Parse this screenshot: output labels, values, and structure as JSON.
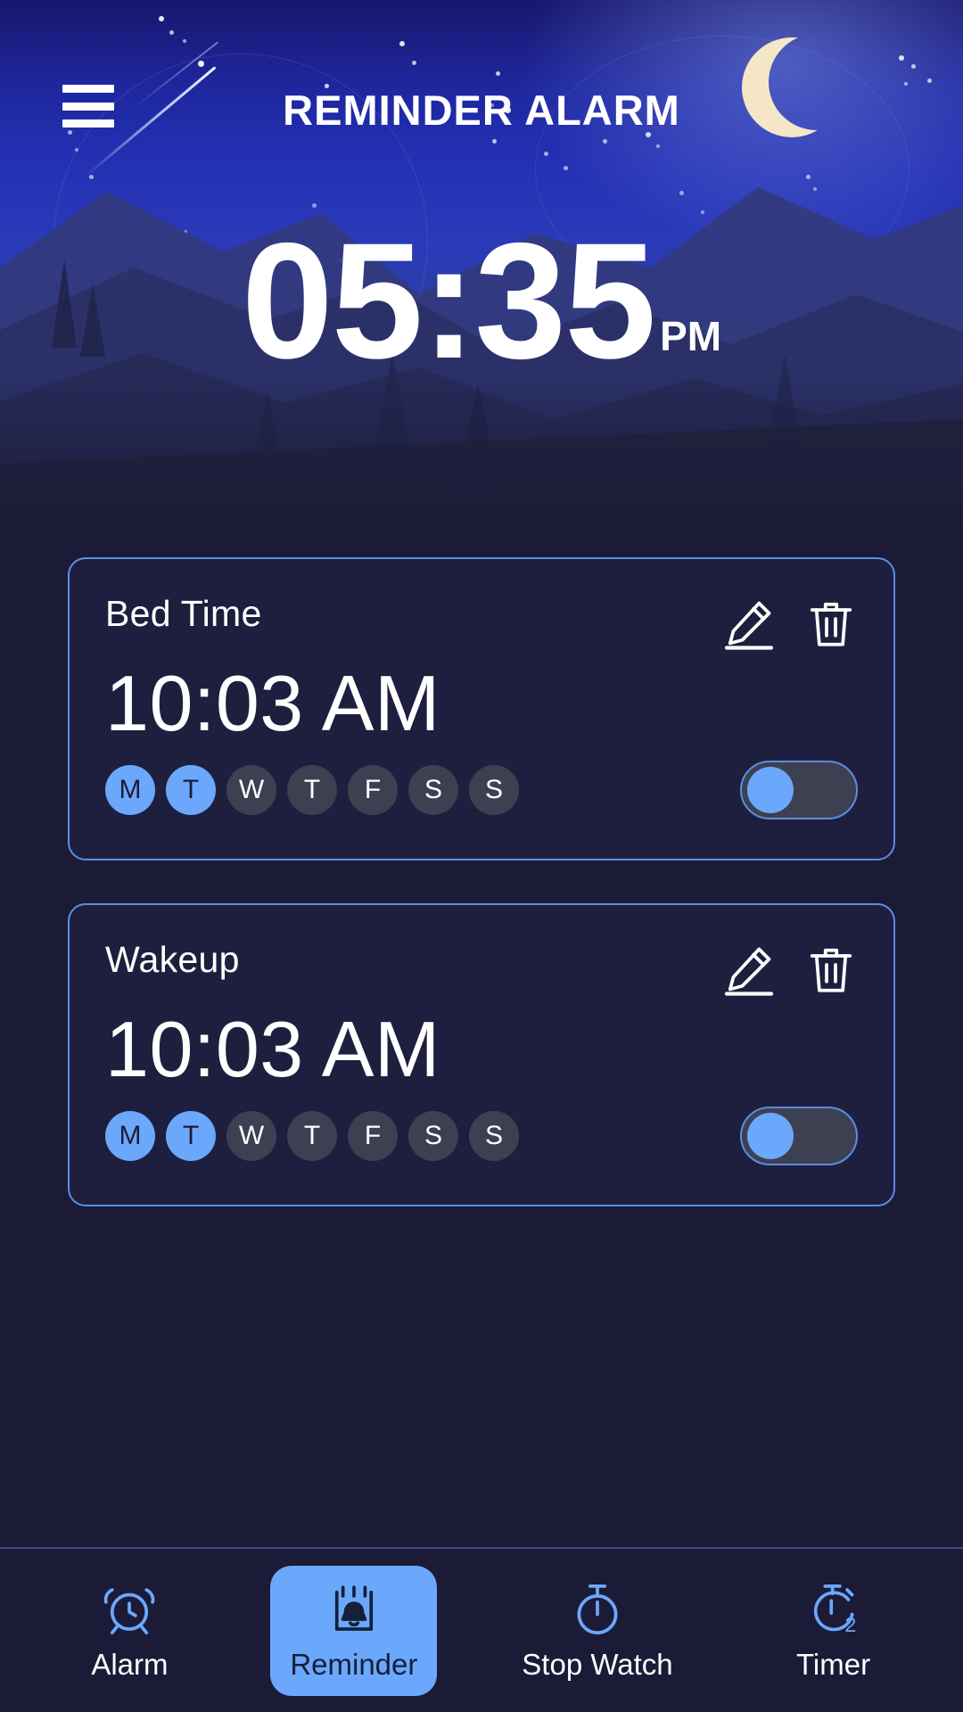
{
  "header": {
    "title": "REMINDER ALARM",
    "menu_icon": "hamburger-menu-icon",
    "moon_icon": "crescent-moon-icon"
  },
  "clock": {
    "time": "05:35",
    "ampm": "PM"
  },
  "alarms": [
    {
      "label": "Bed Time",
      "time": "10:03 AM",
      "edit_icon": "pencil-edit-icon",
      "delete_icon": "trash-delete-icon",
      "days": [
        {
          "letter": "M",
          "active": true
        },
        {
          "letter": "T",
          "active": true
        },
        {
          "letter": "W",
          "active": false
        },
        {
          "letter": "T",
          "active": false
        },
        {
          "letter": "F",
          "active": false
        },
        {
          "letter": "S",
          "active": false
        },
        {
          "letter": "S",
          "active": false
        }
      ],
      "enabled": true
    },
    {
      "label": "Wakeup",
      "time": "10:03 AM",
      "edit_icon": "pencil-edit-icon",
      "delete_icon": "trash-delete-icon",
      "days": [
        {
          "letter": "M",
          "active": true
        },
        {
          "letter": "T",
          "active": true
        },
        {
          "letter": "W",
          "active": false
        },
        {
          "letter": "T",
          "active": false
        },
        {
          "letter": "F",
          "active": false
        },
        {
          "letter": "S",
          "active": false
        },
        {
          "letter": "S",
          "active": false
        }
      ],
      "enabled": true
    }
  ],
  "bottom_nav": {
    "items": [
      {
        "label": "Alarm",
        "icon": "alarm-clock-icon",
        "active": false
      },
      {
        "label": "Reminder",
        "icon": "calendar-bell-icon",
        "active": true
      },
      {
        "label": "Stop Watch",
        "icon": "stopwatch-icon",
        "active": false
      },
      {
        "label": "Timer",
        "icon": "timer-2-icon",
        "active": false
      }
    ]
  },
  "colors": {
    "accent": "#6ba8fb",
    "card_border": "#5c8de0",
    "card_bg": "#1e1f3e",
    "page_bg": "#1b1b37",
    "day_off": "#3d4050",
    "moon": "#f5e6c8"
  }
}
